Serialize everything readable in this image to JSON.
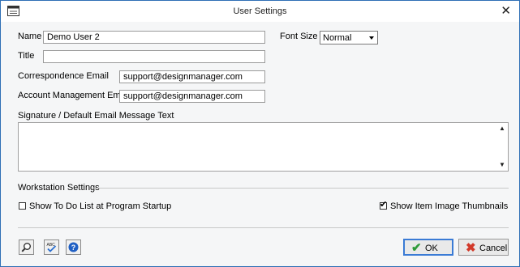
{
  "window": {
    "title": "User Settings",
    "close_glyph": "✕",
    "app_icon": "window-icon"
  },
  "form": {
    "name": {
      "label": "Name",
      "value": "Demo User 2"
    },
    "title": {
      "label": "Title",
      "value": ""
    },
    "correspondence_email": {
      "label": "Correspondence Email",
      "value": "support@designmanager.com"
    },
    "account_management_email": {
      "label": "Account Management Email",
      "value": "support@designmanager.com"
    },
    "font_size": {
      "label": "Font Size",
      "selected": "Normal"
    },
    "signature": {
      "label": "Signature / Default Email Message Text",
      "value": ""
    }
  },
  "workstation": {
    "heading": "Workstation Settings",
    "show_todo": {
      "label": "Show To Do List at Program Startup",
      "checked": false
    },
    "show_thumbnails": {
      "label": "Show Item Image Thumbnails",
      "checked": true,
      "check_glyph": "✔"
    }
  },
  "footer": {
    "tool_icons": [
      "search-icon",
      "spellcheck-icon",
      "help-icon"
    ],
    "spellcheck_text": "ABC",
    "help_text": "?",
    "ok": {
      "label": "OK",
      "glyph": "✔",
      "color": "#2e9b3a"
    },
    "cancel": {
      "label": "Cancel",
      "glyph": "✖",
      "color": "#d23a2a"
    }
  },
  "colors": {
    "accent": "#2f6fb5",
    "focus_border": "#3a7bd5"
  }
}
